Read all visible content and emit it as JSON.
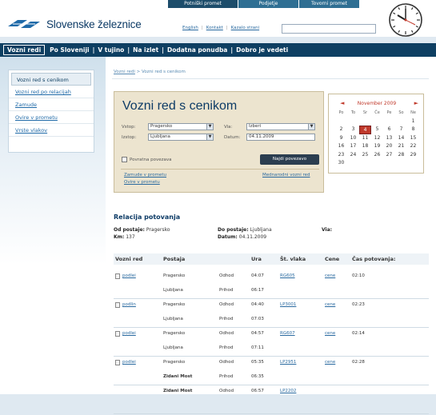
{
  "brand": {
    "name": "Slovenske železnice"
  },
  "top_tabs": [
    "Potniški promet",
    "Podjetje",
    "Tovorni promet"
  ],
  "top_links": [
    "English",
    "Kontakt",
    "Kazalo strani"
  ],
  "nav": [
    "Vozni redi",
    "Po Sloveniji",
    "V tujino",
    "Na izlet",
    "Dodatna ponudba",
    "Dobro je vedeti"
  ],
  "sidebar": [
    "Vozni red s cenikom",
    "Vozni red po relacijah",
    "Zamude",
    "Ovire v prometu",
    "Vrste vlakov"
  ],
  "breadcrumb": [
    "Vozni redi",
    "Vozni red s cenikom"
  ],
  "form": {
    "title": "Vozni red s cenikom",
    "from_label": "Vstop:",
    "from_value": "Pragersko",
    "to_label": "Izstop:",
    "to_value": "Ljubljana",
    "via_label": "Via:",
    "via_value": "Izberi",
    "date_label": "Datum:",
    "date_value": "04.11.2009",
    "return_label": "Povratna povezava",
    "find_button": "Najdi povezavo",
    "links": [
      "Zamude v prometu",
      "Ovire v prometu",
      "Mednarodni vozni red"
    ]
  },
  "calendar": {
    "month": "November 2009",
    "days": [
      "Po",
      "To",
      "Sr",
      "Če",
      "Pe",
      "So",
      "Ne"
    ],
    "weeks": [
      [
        "",
        "",
        "",
        "",
        "",
        "",
        "1"
      ],
      [
        "2",
        "3",
        "4",
        "5",
        "6",
        "7",
        "8"
      ],
      [
        "9",
        "10",
        "11",
        "12",
        "13",
        "14",
        "15"
      ],
      [
        "16",
        "17",
        "18",
        "19",
        "20",
        "21",
        "22"
      ],
      [
        "23",
        "24",
        "25",
        "26",
        "27",
        "28",
        "29"
      ],
      [
        "30",
        "",
        "",
        "",
        "",
        "",
        ""
      ]
    ],
    "selected": "4"
  },
  "relation": {
    "title": "Relacija potovanja",
    "from_label": "Od postaje:",
    "from_value": "Pragersko",
    "km_label": "Km:",
    "km_value": "137",
    "to_label": "Do postaje:",
    "to_value": "Ljubljana",
    "date_label": "Datum:",
    "date_value": "04.11.2009",
    "via_label": "Via:"
  },
  "table": {
    "headers": [
      "Vozni red",
      "Postaja",
      "",
      "Ura",
      "Št. vlaka",
      "Cene",
      "Čas potovanja:"
    ],
    "rows": [
      {
        "link": "podlei",
        "station1": "Pragersko",
        "type1": "Odhod",
        "time1": "04:07",
        "train": "RG605",
        "price": "cene",
        "duration": "02:10",
        "station2": "Ljubljana",
        "type2": "Prihod",
        "time2": "06:17"
      },
      {
        "link": "podlin",
        "station1": "Pragersko",
        "type1": "Odhod",
        "time1": "04:40",
        "train": "LP3001",
        "price": "cene",
        "duration": "02:23",
        "station2": "Ljubljana",
        "type2": "Prihod",
        "time2": "07:03"
      },
      {
        "link": "podlei",
        "station1": "Pragersko",
        "type1": "Odhod",
        "time1": "04:57",
        "train": "RG607",
        "price": "cene",
        "duration": "02:14",
        "station2": "Ljubljana",
        "type2": "Prihod",
        "time2": "07:11"
      },
      {
        "link": "podlei",
        "station1": "Pragersko",
        "type1": "Odhod",
        "time1": "05:35",
        "train": "LP2951",
        "price": "cene",
        "duration": "02:28",
        "station2": "Zidani Most",
        "type2": "Prihod",
        "time2": "06:35"
      },
      {
        "link": "",
        "station1": "Zidani Most",
        "type1": "Odhod",
        "time1": "06:57",
        "train": "LP2202",
        "price": "",
        "duration": "",
        "station2": "",
        "type2": "",
        "time2": ""
      }
    ]
  }
}
